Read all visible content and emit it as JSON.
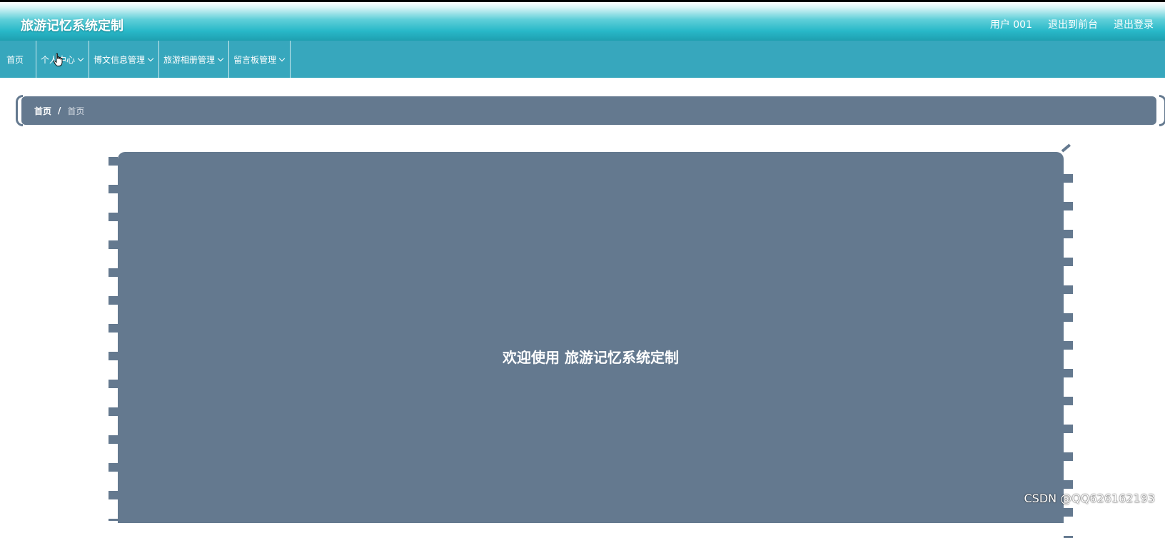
{
  "header": {
    "title": "旅游记忆系统定制",
    "user_label": "用户 001",
    "goto_front": "退出到前台",
    "logout": "退出登录"
  },
  "nav": {
    "items": [
      {
        "label": "首页",
        "has_dropdown": false
      },
      {
        "label": "个人中心",
        "has_dropdown": true
      },
      {
        "label": "博文信息管理",
        "has_dropdown": true
      },
      {
        "label": "旅游相册管理",
        "has_dropdown": true
      },
      {
        "label": "留言板管理",
        "has_dropdown": true
      }
    ]
  },
  "breadcrumb": {
    "home": "首页",
    "separator": "/",
    "current": "首页"
  },
  "main": {
    "welcome_text": "欢迎使用 旅游记忆系统定制"
  },
  "watermark": "CSDN @QQ626162193",
  "colors": {
    "nav_bg": "#37a7bd",
    "header_accent": "#28b8c8",
    "panel_bg": "#64798f",
    "text_light": "#ffffff"
  },
  "icons": {
    "chevron": "chevron-down-icon",
    "cursor": "hand-pointer-icon"
  }
}
